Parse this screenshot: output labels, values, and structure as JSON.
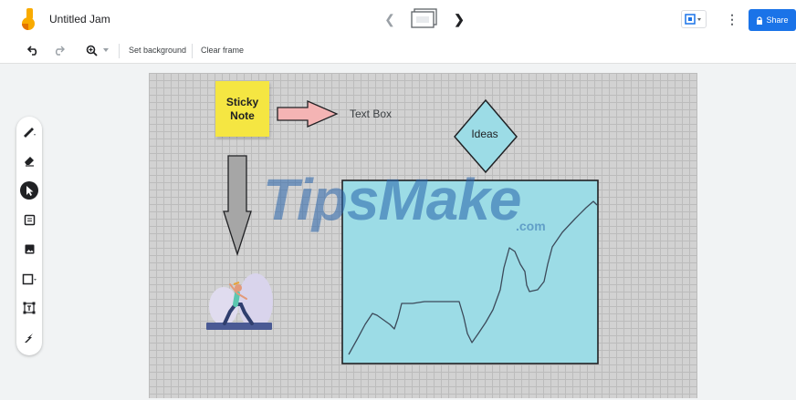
{
  "header": {
    "title": "Untitled Jam",
    "share_label": "Share"
  },
  "toolbar": {
    "set_background_label": "Set background",
    "clear_frame_label": "Clear frame"
  },
  "rail": {
    "tools": [
      "pen-icon",
      "eraser-icon",
      "select-icon",
      "sticky-note-icon",
      "image-icon",
      "shape-icon",
      "text-box-icon",
      "laser-icon"
    ],
    "active_tool": "select-icon"
  },
  "canvas": {
    "sticky_note": "Sticky\nNote",
    "text_box": "Text Box",
    "diamond_label": "Ideas",
    "watermark": "TipsMake",
    "watermark_suffix": ".com"
  },
  "colors": {
    "accent": "#1a73e8",
    "sticky": "#f5e642",
    "chart_fill": "#9cdce6",
    "arrow_pink": "#f4b4b4",
    "arrow_gray": "#a6a6a6"
  }
}
